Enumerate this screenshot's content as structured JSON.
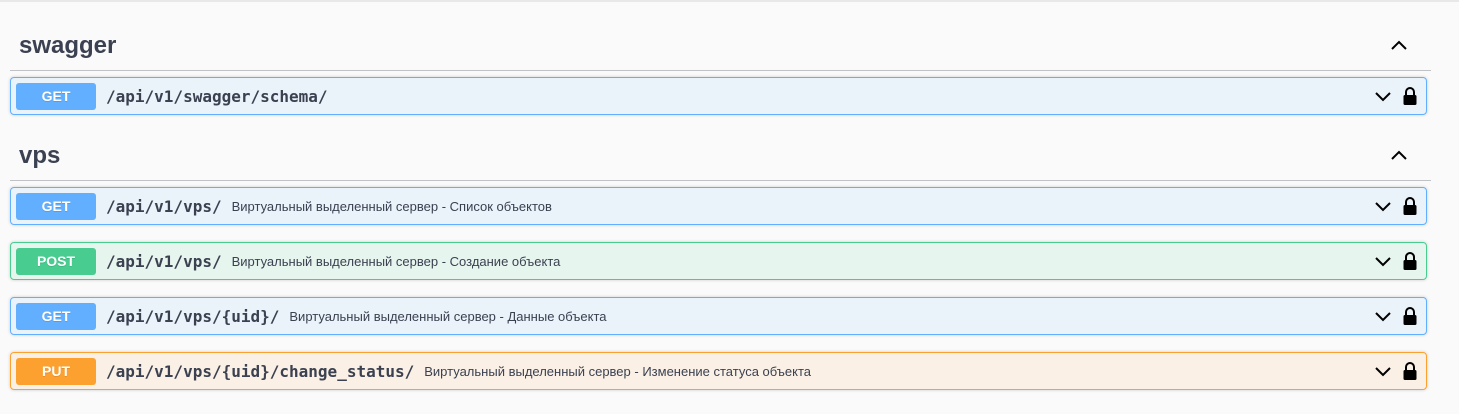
{
  "sections": [
    {
      "title": "swagger",
      "operations": [
        {
          "method": "GET",
          "path": "/api/v1/swagger/schema/",
          "summary": ""
        }
      ]
    },
    {
      "title": "vps",
      "operations": [
        {
          "method": "GET",
          "path": "/api/v1/vps/",
          "summary": "Виртуальный выделенный сервер - Список объектов"
        },
        {
          "method": "POST",
          "path": "/api/v1/vps/",
          "summary": "Виртуальный выделенный сервер - Создание объекта"
        },
        {
          "method": "GET",
          "path": "/api/v1/vps/{uid}/",
          "summary": "Виртуальный выделенный сервер - Данные объекта"
        },
        {
          "method": "PUT",
          "path": "/api/v1/vps/{uid}/change_status/",
          "summary": "Виртуальный выделенный сервер - Изменение статуса объекта"
        }
      ]
    }
  ],
  "colors": {
    "get": "#61affe",
    "post": "#49cc90",
    "put": "#fca130",
    "text": "#3b4151"
  },
  "icons": {
    "collapse": "chevron-up-icon",
    "expand": "chevron-down-icon",
    "auth": "lock-icon"
  }
}
